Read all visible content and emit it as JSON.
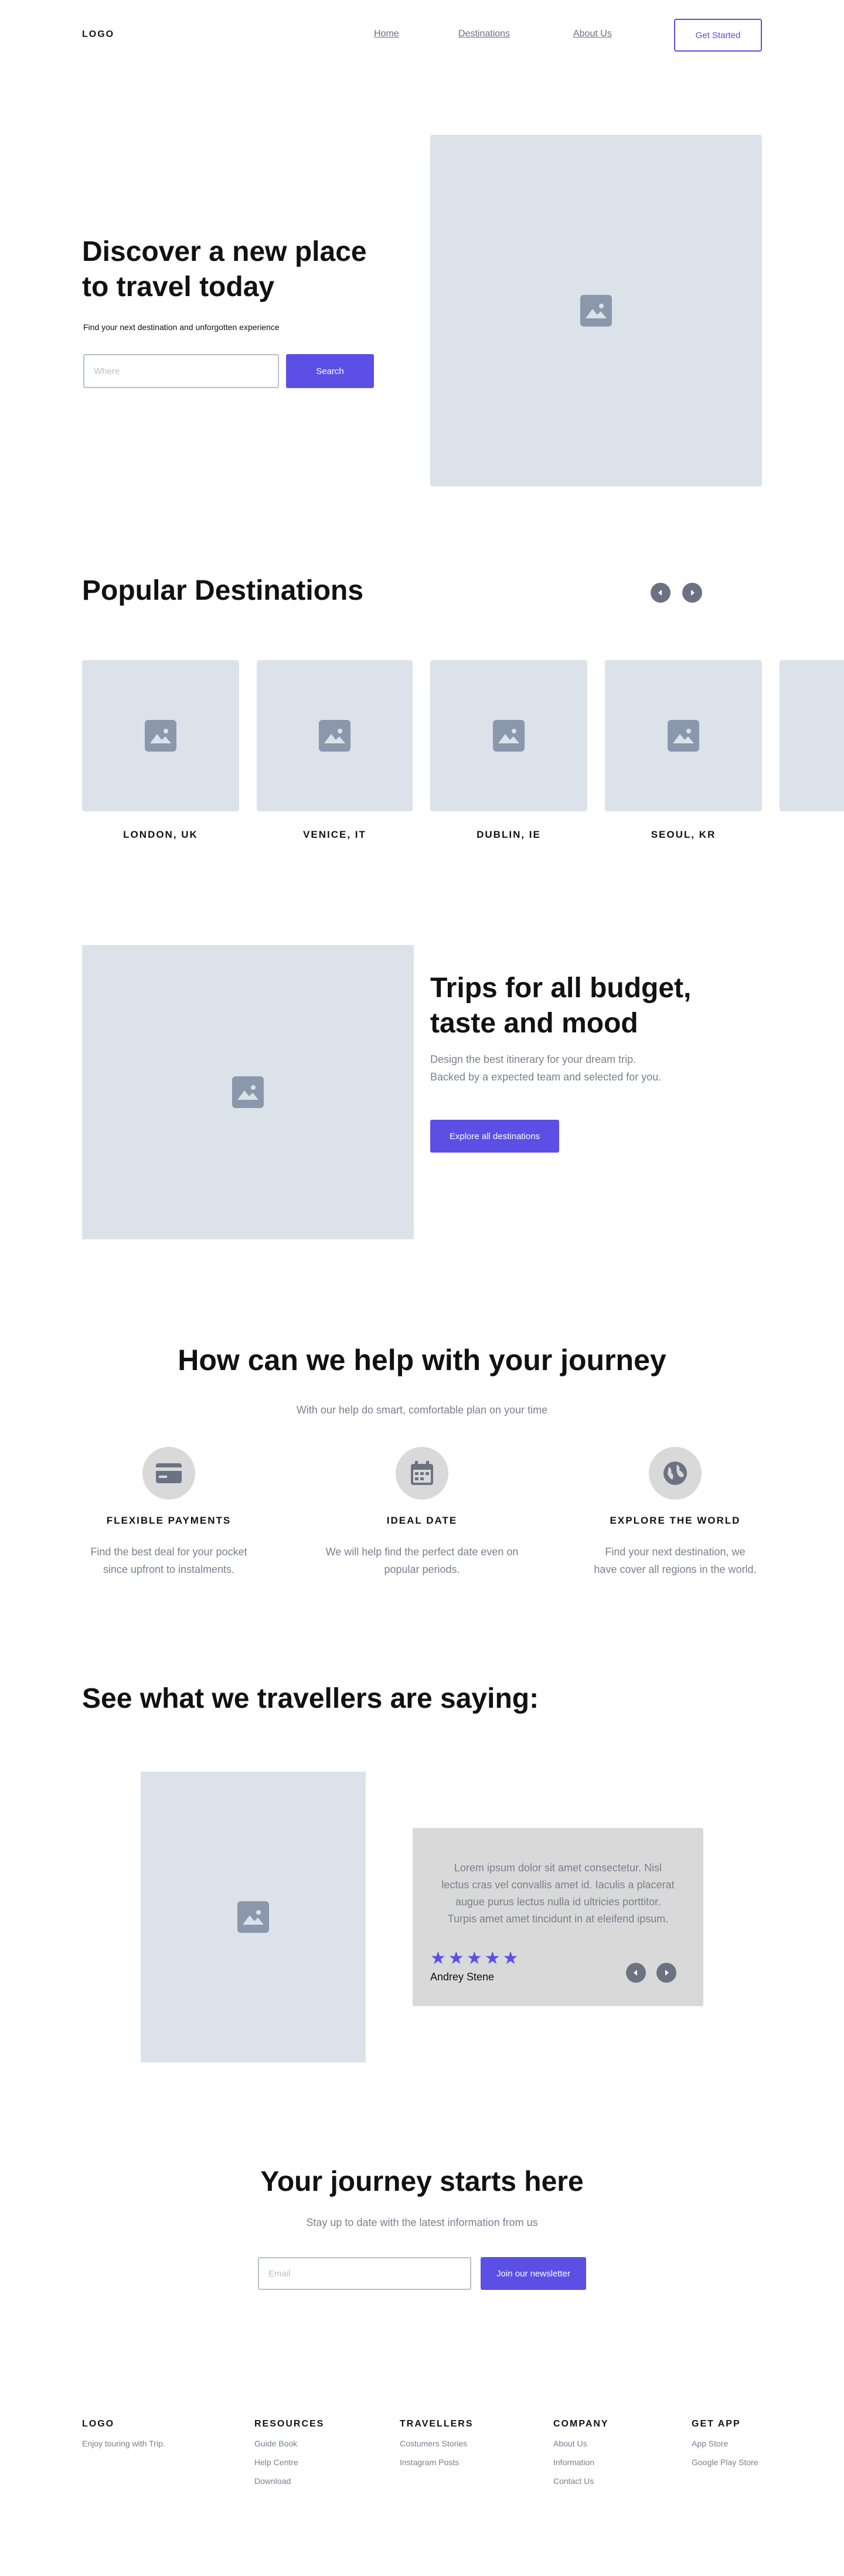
{
  "header": {
    "logo": "LOGO",
    "nav": [
      "Home",
      "Destinations",
      "About Us"
    ],
    "cta_label": "Get Started"
  },
  "hero": {
    "title_line1": "Discover a new place",
    "title_line2": "to travel today",
    "subtitle": "Find your next destination and unforgotten experience",
    "search_placeholder": "Where",
    "search_label": "Search"
  },
  "popular": {
    "title": "Popular Destinations",
    "destinations": [
      "LONDON, UK",
      "VENICE, IT",
      "DUBLIN, IE",
      "SEOUL, KR"
    ]
  },
  "trips": {
    "title_line1": "Trips for all budget,",
    "title_line2": "taste and mood",
    "desc_line1": "Design the best itinerary for your dream trip.",
    "desc_line2": "Backed by a expected team  and selected for you.",
    "button_label": "Explore all destinations"
  },
  "help": {
    "title": "How can we help with your journey",
    "subtitle": "With our help do smart, comfortable plan on your time",
    "features": [
      {
        "title": "FLEXIBLE PAYMENTS",
        "desc1": "Find the best deal for your pocket",
        "desc2": "since upfront to instalments.",
        "icon": "credit-card-icon"
      },
      {
        "title": "IDEAL DATE",
        "desc1": "We will help find the perfect date even on",
        "desc2": "popular periods.",
        "icon": "calendar-icon"
      },
      {
        "title": "EXPLORE THE WORLD",
        "desc1": "Find your next destination, we",
        "desc2": "have cover all regions in the world.",
        "icon": "globe-icon"
      }
    ]
  },
  "testimonials": {
    "title": "See what we travellers are saying:",
    "quote_lines": [
      "Lorem ipsum dolor sit amet consectetur. Nisl",
      "lectus cras vel convallis amet id. Iaculis a placerat",
      "augue purus lectus nulla id ultricies porttitor.",
      "Turpis amet amet tincidunt in at eleifend ipsum."
    ],
    "rating": 5,
    "author": "Andrey Stene",
    "star_color": "#5b4fe6"
  },
  "newsletter": {
    "title": "Your journey starts here",
    "subtitle": "Stay up to date with  the latest information from us",
    "email_placeholder": "Email",
    "button_label": "Join our newsletter"
  },
  "footer": {
    "logo": "LOGO",
    "tagline": "Enjoy touring with Trip.",
    "columns": [
      {
        "title": "RESOURCES",
        "links": [
          "Guide Book",
          "Help Centre",
          "Download"
        ]
      },
      {
        "title": "TRAVELLERS",
        "links": [
          "Costumers Stories",
          "Instagram Posts"
        ]
      },
      {
        "title": "COMPANY",
        "links": [
          "About Us",
          "Information",
          "Contact Us"
        ]
      },
      {
        "title": "GET APP",
        "links": [
          "App Store",
          "Google Play Store"
        ]
      }
    ]
  },
  "colors": {
    "accent": "#5b4fe6",
    "placeholder": "#dbe2ea",
    "muted_text": "#7a7f8f"
  }
}
